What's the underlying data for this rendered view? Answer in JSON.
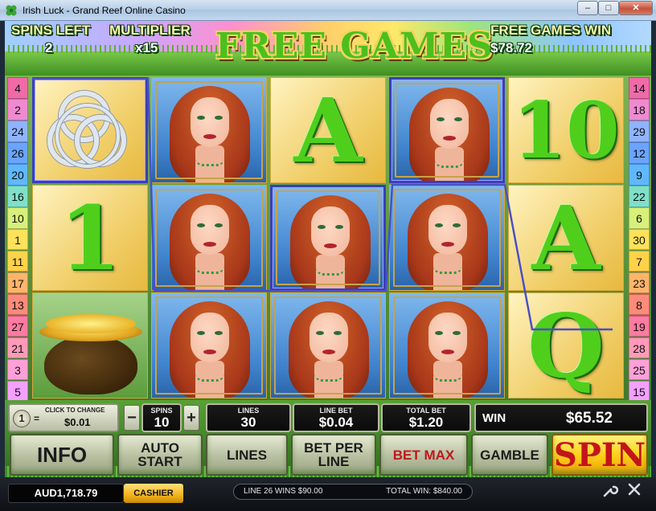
{
  "window": {
    "title": "Irish Luck - Grand Reef Online Casino",
    "minimize_glyph": "–",
    "maximize_glyph": "□",
    "close_glyph": "✕"
  },
  "banner": {
    "spins_left_label": "SPINS LEFT",
    "spins_left_value": "2",
    "multiplier_label": "MULTIPLIER",
    "multiplier_value": "x15",
    "title": "FREE GAMES",
    "free_games_win_label": "FREE GAMES WIN",
    "free_games_win_value": "$78.72"
  },
  "paylines": {
    "left": [
      "4",
      "2",
      "24",
      "26",
      "20",
      "16",
      "10",
      "1",
      "11",
      "17",
      "13",
      "27",
      "21",
      "3",
      "5"
    ],
    "right": [
      "14",
      "18",
      "29",
      "12",
      "9",
      "22",
      "6",
      "30",
      "7",
      "23",
      "8",
      "19",
      "28",
      "25",
      "15"
    ]
  },
  "reels": [
    [
      {
        "symbol": "celtic-knot",
        "win": true
      },
      {
        "symbol": "1",
        "win": false
      },
      {
        "symbol": "pot-of-gold",
        "win": false
      }
    ],
    [
      {
        "symbol": "lady",
        "win": false
      },
      {
        "symbol": "lady",
        "win": false
      },
      {
        "symbol": "lady",
        "win": false
      }
    ],
    [
      {
        "symbol": "A",
        "win": false
      },
      {
        "symbol": "lady",
        "win": true
      },
      {
        "symbol": "lady",
        "win": false
      }
    ],
    [
      {
        "symbol": "lady",
        "win": true
      },
      {
        "symbol": "lady",
        "win": false
      },
      {
        "symbol": "lady",
        "win": false
      }
    ],
    [
      {
        "symbol": "10",
        "win": false
      },
      {
        "symbol": "A",
        "win": false
      },
      {
        "symbol": "Q",
        "win": false
      }
    ]
  ],
  "controls": {
    "coin_icon": "1",
    "coin_equals": "=",
    "click_to_change": "CLICK TO CHANGE",
    "coin_value": "$0.01",
    "spins_minus": "−",
    "spins_label": "SPINS",
    "spins_value": "10",
    "spins_plus": "+",
    "lines_label": "LINES",
    "lines_value": "30",
    "line_bet_label": "LINE BET",
    "line_bet_value": "$0.04",
    "total_bet_label": "TOTAL BET",
    "total_bet_value": "$1.20",
    "win_label": "WIN",
    "win_value": "$65.52",
    "info_label": "INFO",
    "autostart_label": "AUTO START",
    "lines_button_label": "LINES",
    "bet_per_line_label": "BET PER LINE",
    "bet_max_label": "BET MAX",
    "gamble_label": "GAMBLE",
    "spin_label": "SPIN"
  },
  "status": {
    "balance": "AUD1,718.79",
    "cashier_label": "CASHIER",
    "line_message": "LINE 26 WINS $90.00",
    "total_win_message": "TOTAL WIN: $840.00",
    "settings_icon": "wrench-icon",
    "close_icon": "close-icon"
  },
  "colors": {
    "payline": "#4a4fc7",
    "symbol_green": "#4fcf1c",
    "spin_text": "#c3151b"
  }
}
